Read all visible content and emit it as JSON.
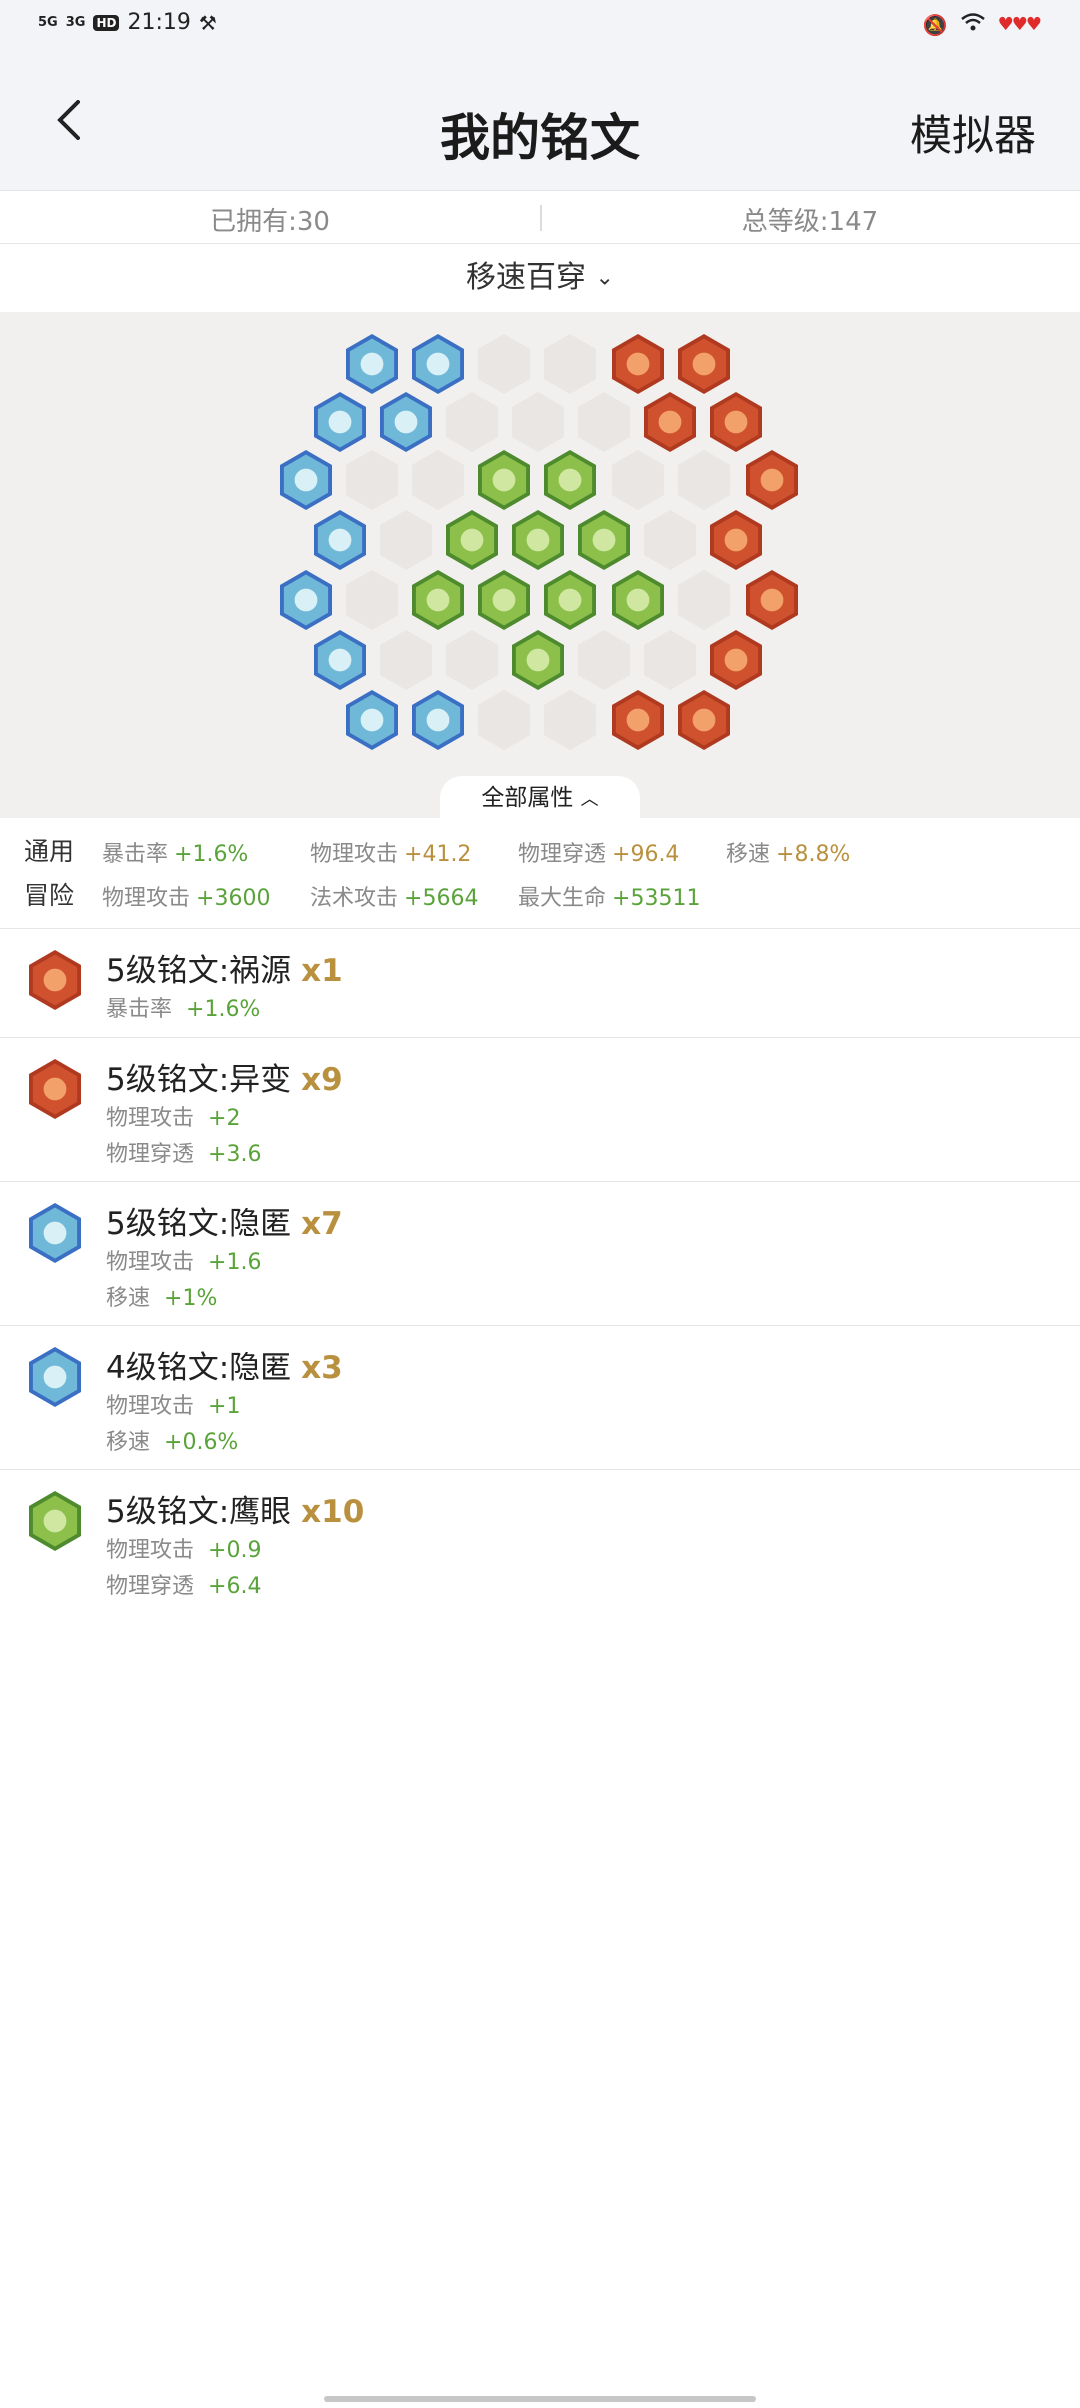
{
  "status": {
    "time": "21:19",
    "sig1": "5G",
    "sig2": "3G",
    "hd": "HD"
  },
  "header": {
    "title": "我的铭文",
    "action": "模拟器"
  },
  "stats": {
    "owned": "已拥有:30",
    "total_level": "总等级:147"
  },
  "filter": {
    "label": "移速百穿"
  },
  "board_tab": {
    "label": "全部属性"
  },
  "colors": {
    "blue": "#3a6fc4",
    "red": "#d0512e",
    "green": "#6aa43a",
    "accent_gold": "#b9913e",
    "value_green": "#5aa33a"
  },
  "attributes": {
    "general_tag": "通用",
    "adventure_tag": "冒险",
    "general": [
      {
        "label": "暴击率",
        "value": "+1.6%"
      },
      {
        "label": "物理攻击",
        "value": "+41.2"
      },
      {
        "label": "物理穿透",
        "value": "+96.4"
      },
      {
        "label": "移速",
        "value": "+8.8%"
      }
    ],
    "adventure": [
      {
        "label": "物理攻击",
        "value": "+3600"
      },
      {
        "label": "法术攻击",
        "value": "+5664"
      },
      {
        "label": "最大生命",
        "value": "+53511"
      }
    ]
  },
  "inscriptions": [
    {
      "title": "5级铭文:祸源",
      "count": "x1",
      "color": "red",
      "stats": [
        {
          "label": "暴击率",
          "value": "+1.6%"
        }
      ]
    },
    {
      "title": "5级铭文:异变",
      "count": "x9",
      "color": "red",
      "stats": [
        {
          "label": "物理攻击",
          "value": "+2"
        },
        {
          "label": "物理穿透",
          "value": "+3.6"
        }
      ]
    },
    {
      "title": "5级铭文:隐匿",
      "count": "x7",
      "color": "blue",
      "stats": [
        {
          "label": "物理攻击",
          "value": "+1.6"
        },
        {
          "label": "移速",
          "value": "+1%"
        }
      ]
    },
    {
      "title": "4级铭文:隐匿",
      "count": "x3",
      "color": "blue",
      "stats": [
        {
          "label": "物理攻击",
          "value": "+1"
        },
        {
          "label": "移速",
          "value": "+0.6%"
        }
      ]
    },
    {
      "title": "5级铭文:鹰眼",
      "count": "x10",
      "color": "green",
      "stats": [
        {
          "label": "物理攻击",
          "value": "+0.9"
        },
        {
          "label": "物理穿透",
          "value": "+6.4"
        }
      ]
    }
  ]
}
